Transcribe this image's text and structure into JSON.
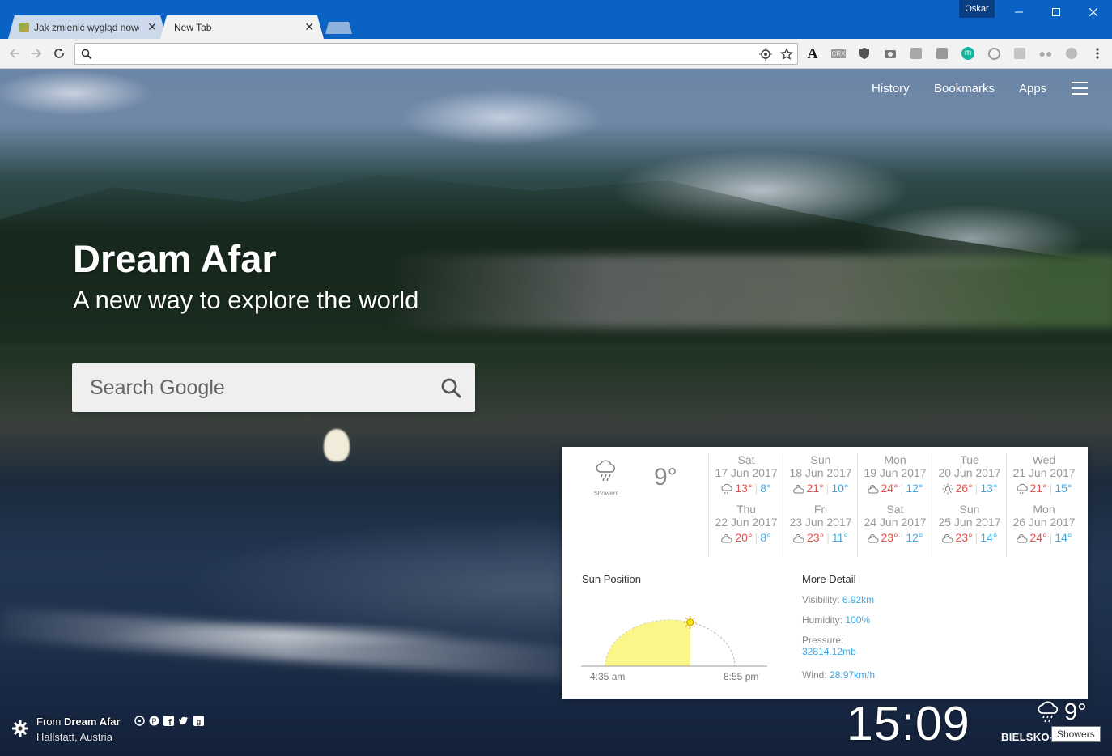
{
  "browser": {
    "tabs": [
      {
        "title": "Jak zmienić wygląd nowe",
        "active": false
      },
      {
        "title": "New Tab",
        "active": true
      }
    ],
    "profile_name": "Oskar",
    "omnibox": {
      "value": "",
      "placeholder": ""
    },
    "extensions": [
      "font-a-icon",
      "crx-icon",
      "ublock-icon",
      "camera-icon",
      "puzzle-icon",
      "window-icon",
      "m-circle-icon",
      "download-circle-icon",
      "grid-icon",
      "dots-icon",
      "leaf-icon",
      "menu-kebab-icon"
    ]
  },
  "nav": {
    "history": "History",
    "bookmarks": "Bookmarks",
    "apps": "Apps"
  },
  "hero": {
    "title": "Dream Afar",
    "subtitle": "A new way to explore the world",
    "search_placeholder": "Search Google"
  },
  "weather": {
    "current": {
      "condition": "Showers",
      "temp": "9°",
      "icon": "rain-cloud-icon"
    },
    "forecast": [
      {
        "day": "Sat",
        "date": "17 Jun 2017",
        "high": "13°",
        "low": "8°",
        "icon": "rain-cloud-icon"
      },
      {
        "day": "Sun",
        "date": "18 Jun 2017",
        "high": "21°",
        "low": "10°",
        "icon": "partly-cloudy-icon"
      },
      {
        "day": "Mon",
        "date": "19 Jun 2017",
        "high": "24°",
        "low": "12°",
        "icon": "partly-cloudy-icon"
      },
      {
        "day": "Tue",
        "date": "20 Jun 2017",
        "high": "26°",
        "low": "13°",
        "icon": "sun-icon"
      },
      {
        "day": "Wed",
        "date": "21 Jun 2017",
        "high": "21°",
        "low": "15°",
        "icon": "rain-cloud-icon"
      },
      {
        "day": "Thu",
        "date": "22 Jun 2017",
        "high": "20°",
        "low": "8°",
        "icon": "partly-cloudy-icon"
      },
      {
        "day": "Fri",
        "date": "23 Jun 2017",
        "high": "23°",
        "low": "11°",
        "icon": "partly-cloudy-icon"
      },
      {
        "day": "Sat",
        "date": "24 Jun 2017",
        "high": "23°",
        "low": "12°",
        "icon": "partly-cloudy-icon"
      },
      {
        "day": "Sun",
        "date": "25 Jun 2017",
        "high": "23°",
        "low": "14°",
        "icon": "partly-cloudy-icon"
      },
      {
        "day": "Mon",
        "date": "26 Jun 2017",
        "high": "24°",
        "low": "14°",
        "icon": "partly-cloudy-icon"
      }
    ],
    "sun_position": {
      "title": "Sun Position",
      "sunrise": "4:35 am",
      "sunset": "8:55 pm",
      "progress": 0.6
    },
    "more_detail": {
      "title": "More Detail",
      "visibility_label": "Visibility:",
      "visibility": "6.92km",
      "humidity_label": "Humidity:",
      "humidity": "100%",
      "pressure_label": "Pressure:",
      "pressure": "32814.12mb",
      "wind_label": "Wind:",
      "wind": "28.97km/h"
    },
    "colors": {
      "high": "#e2514b",
      "low": "#3fa7e3",
      "sun_fill": "#fbf68a"
    }
  },
  "footer": {
    "from_prefix": "From",
    "source": "Dream Afar",
    "location": "Hallstatt, Austria",
    "time": "15:09",
    "temp": "9°",
    "city": "BIELSKO-",
    "tooltip": "Showers"
  }
}
